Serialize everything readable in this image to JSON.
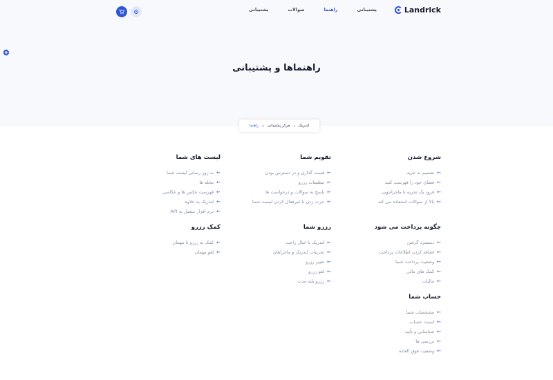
{
  "header": {
    "logo_text": "Landrick",
    "nav": [
      {
        "label": "پشتیبانی",
        "active": false
      },
      {
        "label": "راهنما",
        "active": true
      },
      {
        "label": "سوالات",
        "active": false
      },
      {
        "label": "پشتیبانی",
        "active": false
      }
    ],
    "buttons": [
      {
        "icon": "shopping-cart-icon"
      },
      {
        "icon": "settings-icon"
      }
    ]
  },
  "page": {
    "title": "راهنماها و پشتیبانی"
  },
  "breadcrumb": {
    "items": [
      "لندریک",
      "مرکز پشتیبانی"
    ],
    "active": "راهنما"
  },
  "sections": [
    {
      "key": "start",
      "title": "شروع شدن",
      "items": [
        "تصمیم به خرید",
        "فضای خود را فهرست کنید",
        "فرود یک تجربه یا ماجراجویی",
        "بالا از سوالات استفاده می کند"
      ]
    },
    {
      "key": "calendar",
      "title": "تقویم شما",
      "items": [
        "قیمت گذاری و در دسترس بودن",
        "تنظیمات رزرو",
        "پاسخ به سوالات و درخواست ها",
        "جرت زدن یا غیرفعال کردن لیست شما"
      ]
    },
    {
      "key": "listings",
      "title": "لیست های شما",
      "items": [
        "به روز رسانی لیست شما",
        "محله ها",
        "فهرست عکس ها و عکاسی",
        "لندریک به علاوه",
        "نرم افزار متصل به API"
      ]
    },
    {
      "key": "payment",
      "title": "چگونه پرداخت می شود",
      "items": [
        "دستمزد گرفتن",
        "اضافه کردن اطلاعات پرداخت",
        "وضعیت پرداخت شما",
        "کمک های مالی",
        "مالیات"
      ]
    },
    {
      "key": "reservations",
      "title": "رزرو شما",
      "items": [
        "لندریک با خیال راحت",
        "تجربیات لندریک و ماجراهای",
        "تغییر رزرو",
        "لغو رزرو",
        "رزرو بلند مدت"
      ]
    },
    {
      "key": "help",
      "title": "کمک رزرو",
      "items": [
        "کمک به رزرو با مهمان",
        "لغو مهمان"
      ]
    },
    {
      "key": "account",
      "title": "حساب شما",
      "items": [
        "مشخصات شما",
        "امنیت حساب",
        "شناسایی و تأیید",
        "بررسی ها",
        "وضعیت فوق العاده"
      ]
    }
  ]
}
